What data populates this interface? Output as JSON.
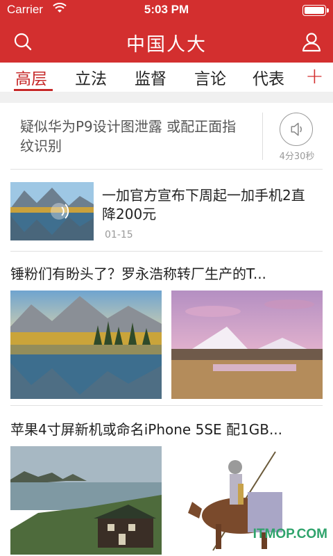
{
  "status_bar": {
    "carrier": "Carrier",
    "time": "5:03 PM",
    "battery_level": 1.0
  },
  "nav_bar": {
    "title": "中国人大",
    "left_icon": "search-icon",
    "right_icon": "user-icon"
  },
  "tabs": [
    {
      "label": "高层",
      "active": true
    },
    {
      "label": "立法",
      "active": false
    },
    {
      "label": "监督",
      "active": false
    },
    {
      "label": "言论",
      "active": false
    },
    {
      "label": "代表",
      "active": false
    }
  ],
  "tabs_add_label": "+",
  "audio_item": {
    "title": "疑似华为P9设计图泄露 或配正面指纹识别",
    "duration": "4分30秒",
    "icon": "speaker-icon"
  },
  "news_small": {
    "title": "一加官方宣布下周起一加手机2直降200元",
    "date": "01-15"
  },
  "news_multi": [
    {
      "title": "锤粉们有盼头了？罗永浩称转厂生产的T..."
    },
    {
      "title": "苹果4寸屏新机或命名iPhone 5SE 配1GB..."
    }
  ],
  "watermark": "ITMOP.COM",
  "colors": {
    "brand_red": "#d32f2f",
    "text_dark": "#222222",
    "text_gray": "#999999"
  }
}
